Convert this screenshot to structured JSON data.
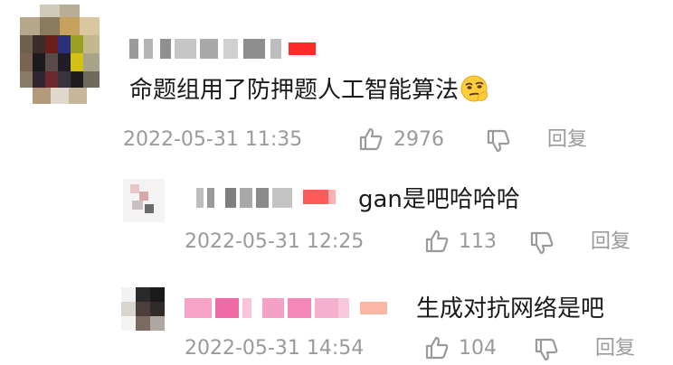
{
  "comments": [
    {
      "text": "命题组用了防押题人工智能算法",
      "emoji": "smirk-face",
      "timestamp": "2022-05-31 11:35",
      "likes": "2976",
      "reply_label": "回复"
    },
    {
      "text": "gan是吧哈哈哈",
      "timestamp": "2022-05-31 12:25",
      "likes": "113",
      "reply_label": "回复"
    },
    {
      "text": "生成对抗网络是吧",
      "timestamp": "2022-05-31 14:54",
      "likes": "104",
      "reply_label": "回复"
    }
  ],
  "colors": {
    "text": "#1a1a1a",
    "meta": "#9a9a9a",
    "badge": "#ff2b2b"
  },
  "icons": [
    "thumbs-up-icon",
    "thumbs-down-icon"
  ]
}
